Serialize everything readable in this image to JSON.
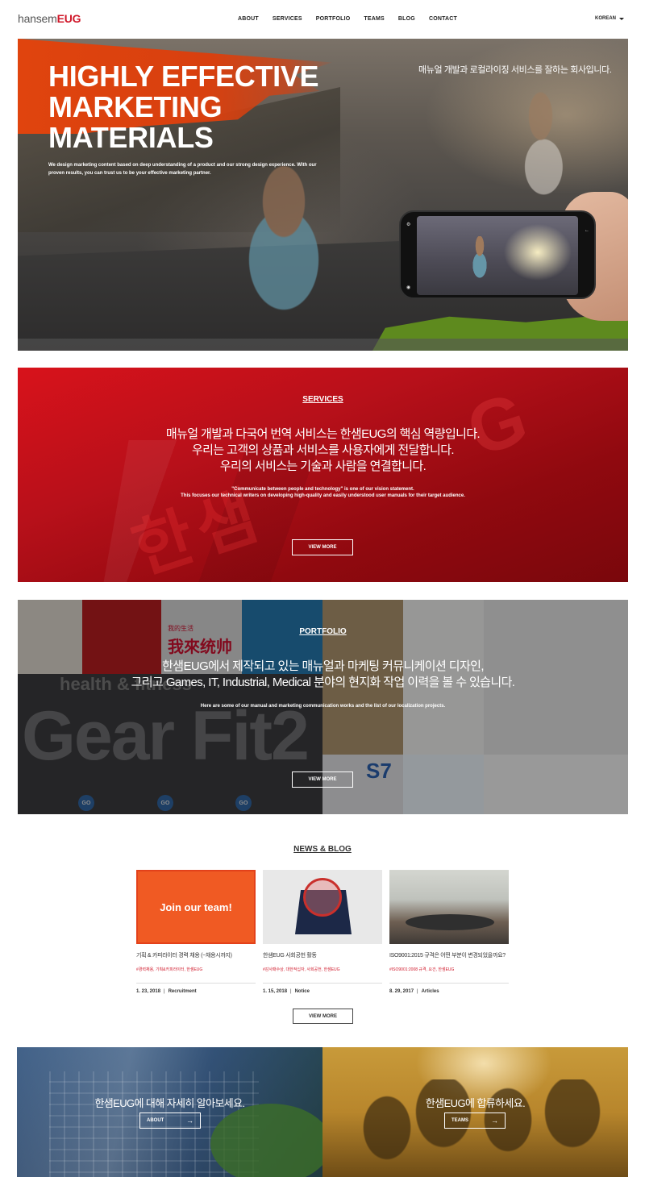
{
  "header": {
    "logo_part1": "hansem",
    "logo_part2": "EUG",
    "nav": [
      "ABOUT",
      "SERVICES",
      "PORTFOLIO",
      "TEAMS",
      "BLOG",
      "CONTACT"
    ],
    "language": "KOREAN"
  },
  "hero": {
    "title_line1": "HIGHLY EFFECTIVE",
    "title_line2": "MARKETING",
    "title_line3": "MATERIALS",
    "description": "We design marketing content based on deep understanding of a product and our strong design experience. With our proven results, you can trust us to be your effective marketing partner.",
    "tagline": "매뉴얼 개발과 로컬라이징 서비스를 잘하는 회사입니다."
  },
  "services": {
    "title": "SERVICES",
    "kr_line1": "매뉴얼 개발과 다국어 번역 서비스는 한샘EUG의 핵심 역량입니다.",
    "kr_line2": "우리는 고객의 상품과 서비스를 사용자에게 전달합니다.",
    "kr_line3": "우리의 서비스는 기술과 사람을 연결합니다.",
    "en_line1": "\"Communicate between people and technology\" is one of our vision statement.",
    "en_line2": "This focuses our technical writers on developing high-quality and easily understood user manuals for their target audience.",
    "button": "VIEW MORE"
  },
  "portfolio": {
    "title": "PORTFOLIO",
    "kr_line1": "한샘EUG에서 제작되고 있는 매뉴얼과 마케팅 커뮤니케이션 디자인,",
    "kr_line2": "그리고 Games, IT, Industrial, Medical 분야의 현지화 작업 이력을 볼 수 있습니다.",
    "en_line": "Here are some of our manual and marketing communication works and the list of our localization projects.",
    "button": "VIEW MORE",
    "tile_text": {
      "gear": "Gear Fit2",
      "health": "health & fitness",
      "s7": "S7",
      "chinese_small": "我的生活",
      "chinese_big": "我來统帅",
      "go": "GO"
    }
  },
  "news": {
    "title": "NEWS & BLOG",
    "cards": [
      {
        "thumb_text": "Join our team!",
        "title": "기획 & 카피라이터 경력 채용 (~채용시까지)",
        "tags": "#경력채용, 기획&카피라이터, 한샘EUG",
        "date": "1. 23, 2018",
        "category": "Recruitment"
      },
      {
        "thumb_text": "",
        "title": "한샘EUG 사회공헌 활동",
        "tags": "#감사패수상, 대한적십자, 사회공헌, 한샘EUG",
        "date": "1. 15, 2018",
        "category": "Notice"
      },
      {
        "thumb_text": "",
        "title": "ISO9001:2015 규격은 어떤 부분이 변경되었을까요?",
        "tags": "#ISO9001:2008 규격, 요건, 한샘EUG",
        "date": "8. 29, 2017",
        "category": "Articles"
      }
    ],
    "button": "VIEW MORE"
  },
  "bottom": {
    "left_text": "한샘EUG에 대해 자세히 알아보세요.",
    "left_button": "ABOUT",
    "right_text": "한샘EUG에 합류하세요.",
    "right_button": "TEAMS",
    "arrow": "→"
  },
  "colors": {
    "brand_red": "#d0182a",
    "hero_orange": "#e0440e",
    "join_orange": "#f05a23"
  }
}
